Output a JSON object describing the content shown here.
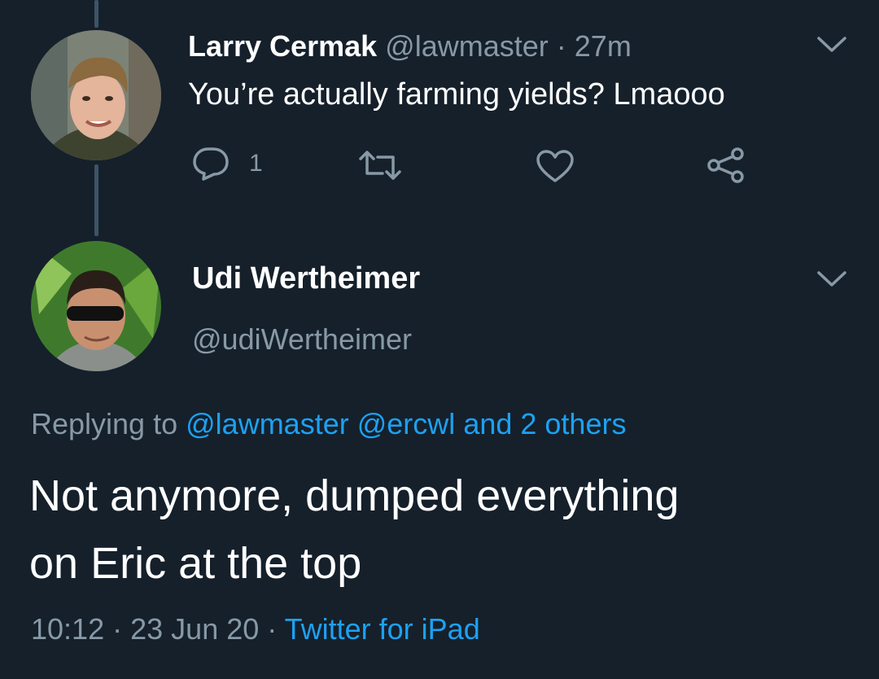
{
  "tweet": {
    "author_name": "Larry Cermak",
    "handle": "@lawmaster",
    "separator": "·",
    "time_ago": "27m",
    "text": "You’re actually farming yields? Lmaooo",
    "reply_count": "1",
    "icons": [
      "reply-icon",
      "retweet-icon",
      "like-icon",
      "share-icon",
      "chevron-down-icon"
    ]
  },
  "reply": {
    "author_name": "Udi Wertheimer",
    "handle": "@udiWertheimer",
    "replying_prefix": "Replying to",
    "mentions": [
      "@lawmaster",
      "@ercwl"
    ],
    "others": "and 2 others",
    "text_line1": "Not anymore, dumped everything",
    "text_line2": "on Eric at the top",
    "time": "10:12",
    "separator": "·",
    "date": "23 Jun 20",
    "source": "Twitter for iPad"
  },
  "colors": {
    "background": "#15202b",
    "text": "#ffffff",
    "muted": "#8899a6",
    "link": "#1da1f2",
    "thread_line": "#3d5466"
  }
}
